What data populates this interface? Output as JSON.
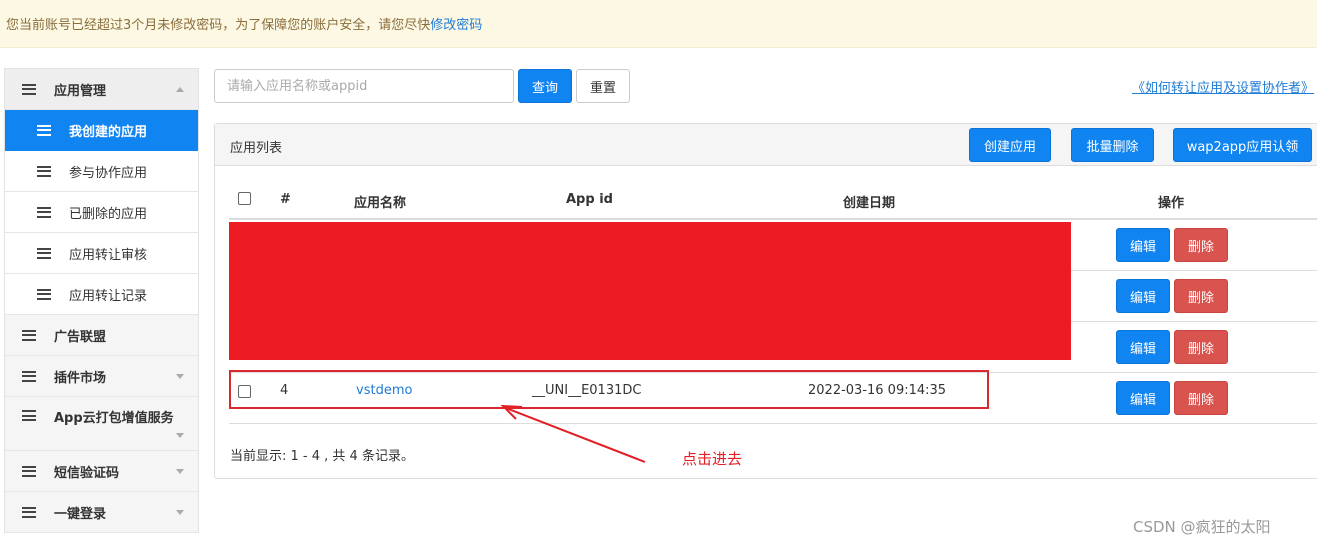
{
  "notice": {
    "text": "您当前账号已经超过3个月未修改密码，为了保障您的账户安全，请您尽快",
    "link": "修改密码"
  },
  "sidebar": {
    "items": [
      {
        "label": "应用管理",
        "type": "group",
        "caret": "up"
      },
      {
        "label": "我创建的应用",
        "type": "sub",
        "active": true
      },
      {
        "label": "参与协作应用",
        "type": "sub"
      },
      {
        "label": "已删除的应用",
        "type": "sub"
      },
      {
        "label": "应用转让审核",
        "type": "sub"
      },
      {
        "label": "应用转让记录",
        "type": "sub"
      },
      {
        "label": "广告联盟",
        "type": "group"
      },
      {
        "label": "插件市场",
        "type": "group",
        "caret": "down"
      },
      {
        "label": "App云打包增值服务",
        "type": "group",
        "caret": "down"
      },
      {
        "label": "短信验证码",
        "type": "group",
        "caret": "down"
      },
      {
        "label": "一键登录",
        "type": "group",
        "caret": "down"
      }
    ]
  },
  "search": {
    "placeholder": "请输入应用名称或appid",
    "query_label": "查询",
    "reset_label": "重置"
  },
  "help_link": "《如何转让应用及设置协作者》",
  "panel": {
    "title": "应用列表",
    "create_label": "创建应用",
    "batch_delete_label": "批量删除",
    "wap2app_label": "wap2app应用认领"
  },
  "table": {
    "headers": {
      "num": "#",
      "name": "应用名称",
      "appid": "App id",
      "date": "创建日期",
      "ops": "操作"
    },
    "rows": [
      {
        "num": "",
        "name": "",
        "appid": "",
        "date": ""
      },
      {
        "num": "",
        "name": "",
        "appid": "",
        "date": ""
      },
      {
        "num": "",
        "name": "",
        "appid": "",
        "date": ""
      },
      {
        "num": "4",
        "name": "vstdemo",
        "appid": "__UNI__E0131DC",
        "date": "2022-03-16 09:14:35"
      }
    ],
    "edit_label": "编辑",
    "delete_label": "删除"
  },
  "footer": "当前显示: 1 - 4 , 共 4 条记录。",
  "annotation": "点击进去",
  "watermark": "CSDN @疯狂的太阳",
  "colors": {
    "primary": "#1084f1",
    "danger": "#d9534f",
    "redaction": "#ed1c24",
    "annotation": "#e31e24",
    "notice_bg": "#fcf8e3"
  }
}
